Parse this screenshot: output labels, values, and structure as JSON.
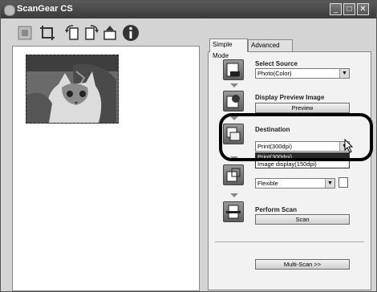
{
  "window": {
    "title": "ScanGear CS"
  },
  "tabs": [
    {
      "label": "Simple Mode",
      "active": true
    },
    {
      "label": "Advanced Mode",
      "active": false
    }
  ],
  "steps": {
    "select_source": {
      "label": "Select Source",
      "value": "Photo(Color)"
    },
    "preview": {
      "label": "Display Preview Image",
      "button": "Preview"
    },
    "destination": {
      "label": "Destination",
      "value": "Print(300dpi)",
      "options": [
        "Print(300dpi)",
        "Image display(150dpi)"
      ],
      "selected_index": 0
    },
    "output_size": {
      "value": "Flexible"
    },
    "perform_scan": {
      "label": "Perform Scan",
      "button": "Scan"
    }
  },
  "multiscan_button": "Multi-Scan >>",
  "icons": {
    "toolbar": [
      "scan-area-icon",
      "crop-icon",
      "rotate-left-icon",
      "rotate-right-icon",
      "flip-icon",
      "info-icon"
    ]
  }
}
